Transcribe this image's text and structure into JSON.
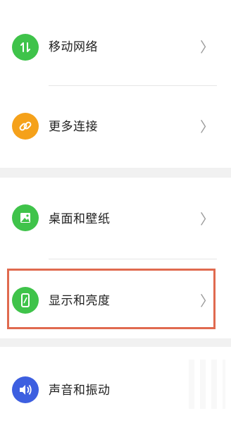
{
  "settings_items": [
    {
      "label": "移动网络",
      "icon": "mobile-network-icon",
      "color": "#3fc34a"
    },
    {
      "label": "更多连接",
      "icon": "link-icon",
      "color": "#f5a11a"
    },
    {
      "label": "桌面和壁纸",
      "icon": "wallpaper-icon",
      "color": "#3fc34a"
    },
    {
      "label": "显示和亮度",
      "icon": "display-brightness-icon",
      "color": "#3fc34a"
    },
    {
      "label": "声音和振动",
      "icon": "sound-vibration-icon",
      "color": "#3d5fe0"
    }
  ],
  "chevron": "〉",
  "highlight_color": "#e06a4f"
}
